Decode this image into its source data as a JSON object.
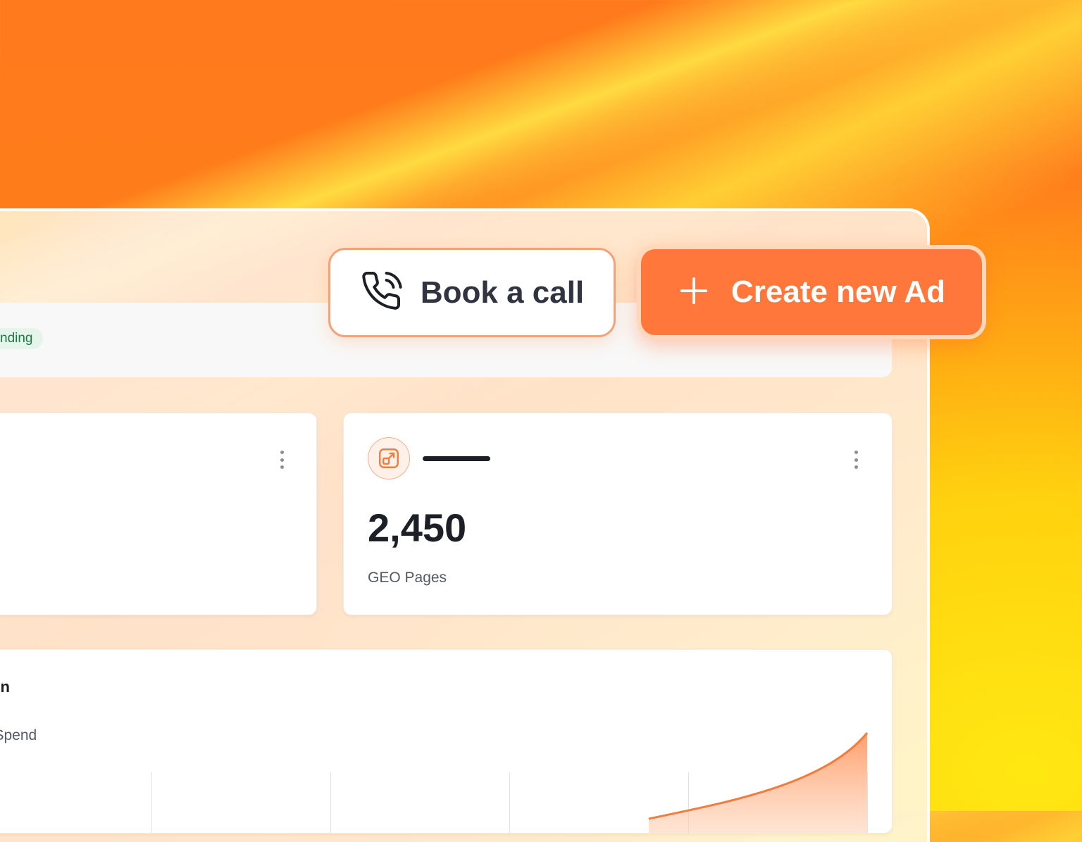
{
  "header": {
    "book_call_label": "Book a call",
    "create_ad_label": "Create new Ad"
  },
  "status_pill": {
    "label": "nding"
  },
  "stat_card": {
    "value": "2,450",
    "label": "GEO Pages"
  },
  "chart_card": {
    "title": "ion",
    "subtitle": "l Spend"
  },
  "colors": {
    "accent": "#ff773a",
    "accent_border": "#f4a27a",
    "text_dark": "#1c1f26",
    "status_green": "#1d7a43"
  },
  "icons": [
    "phone-call-icon",
    "plus-icon",
    "external-link-icon",
    "more-vertical-icon"
  ],
  "chart_data": {
    "type": "area",
    "series": [
      {
        "values": [
          0,
          0,
          0,
          0.02,
          0.2,
          1.0
        ]
      }
    ]
  }
}
